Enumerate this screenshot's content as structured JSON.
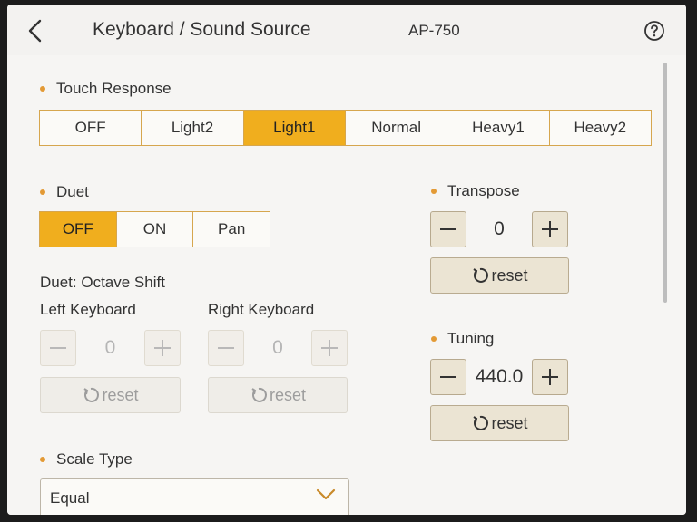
{
  "header": {
    "title": "Keyboard / Sound Source",
    "model": "AP-750"
  },
  "touch_response": {
    "label": "Touch Response",
    "options": [
      "OFF",
      "Light2",
      "Light1",
      "Normal",
      "Heavy1",
      "Heavy2"
    ],
    "selected": "Light1"
  },
  "duet": {
    "label": "Duet",
    "options": [
      "OFF",
      "ON",
      "Pan"
    ],
    "selected": "OFF",
    "octave_shift_label": "Duet: Octave Shift",
    "left": {
      "label": "Left Keyboard",
      "value": "0",
      "reset_label": "reset"
    },
    "right": {
      "label": "Right Keyboard",
      "value": "0",
      "reset_label": "reset"
    }
  },
  "transpose": {
    "label": "Transpose",
    "value": "0",
    "reset_label": "reset"
  },
  "tuning": {
    "label": "Tuning",
    "value": "440.0",
    "reset_label": "reset"
  },
  "scale_type": {
    "label": "Scale Type",
    "selected": "Equal"
  },
  "icons": {
    "back": "chevron-left-icon",
    "help": "question-circle-icon",
    "minus": "minus-icon",
    "plus": "plus-icon",
    "reset": "refresh-icon",
    "dropdown": "chevron-down-icon"
  },
  "colors": {
    "accent": "#f0ae1e",
    "border": "#d6a64e",
    "bullet": "#e39a35"
  }
}
